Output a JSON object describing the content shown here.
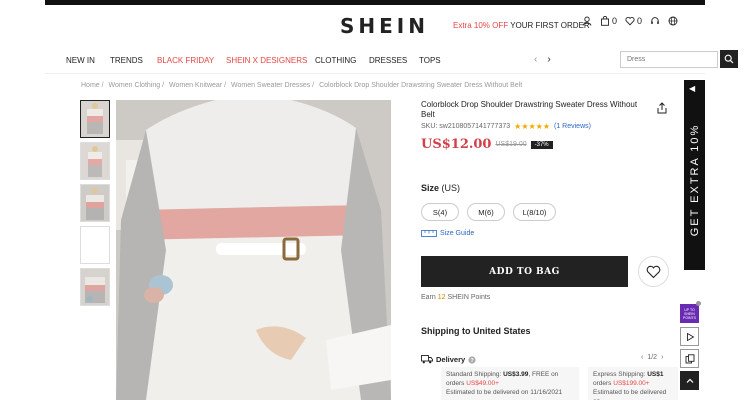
{
  "header": {
    "logo": "SHEIN",
    "promo_red": "Extra 10% OFF",
    "promo_dark": "YOUR FIRST ORDER",
    "bag_count": "0",
    "wishlist_count": "0"
  },
  "nav": {
    "items": [
      {
        "label": "NEW IN",
        "color": "#222222"
      },
      {
        "label": "TRENDS",
        "color": "#222222"
      },
      {
        "label": "BLACK FRIDAY",
        "color": "#e64545"
      },
      {
        "label": "SHEIN X DESIGNERS",
        "color": "#e64545"
      },
      {
        "label": "CLOTHING",
        "color": "#222222"
      },
      {
        "label": "DRESSES",
        "color": "#222222"
      },
      {
        "label": "TOPS",
        "color": "#222222"
      }
    ],
    "search_placeholder": "Dress"
  },
  "breadcrumb": [
    "Home /",
    "Women Clothing /",
    "Women Knitwear /",
    "Women Sweater Dresses /",
    "Colorblock Drop Shoulder Drawstring Sweater Dress Without Belt"
  ],
  "product": {
    "title": "Colorblock Drop Shoulder Drawstring Sweater Dress Without Belt",
    "sku": "SKU: sw2108057141777373",
    "stars": "★★★★★",
    "reviews": "(1 Reviews)",
    "rating": 5,
    "price_now": "US$12.00",
    "price_was": "US$19.00",
    "discount": "-37%"
  },
  "size": {
    "label": "Size",
    "region": "(US)",
    "options": [
      "S(4)",
      "M(6)",
      "L(8/10)"
    ],
    "guide": "Size Guide"
  },
  "actions": {
    "add_to_bag": "ADD TO BAG"
  },
  "points": {
    "prefix": "Earn",
    "value": "12",
    "suffix": "SHEIN Points"
  },
  "shipping": {
    "title": "Shipping to United States",
    "delivery_label": "Delivery",
    "pager": "1/2",
    "standard": {
      "label": "Standard Shipping:",
      "price": "US$3.99",
      "free_text": ", FREE on orders",
      "threshold": "US$49.00+",
      "estimate": "Estimated to be delivered on 11/16/2021"
    },
    "express": {
      "label": "Express Shipping:",
      "price": "US$1",
      "free_text": "orders",
      "threshold": "US$199.00+",
      "estimate": "Estimated to be delivered on"
    }
  },
  "side_banner": {
    "text": "GET EXTRA 10%"
  },
  "floating": {
    "badge_lines": [
      "UP TO",
      "SHEIN",
      "POINTS"
    ]
  },
  "colors": {
    "accent_red": "#e64545",
    "price_red": "#d2404a",
    "link_blue": "#2b66c4",
    "star": "#f2a900",
    "dark": "#222222"
  }
}
